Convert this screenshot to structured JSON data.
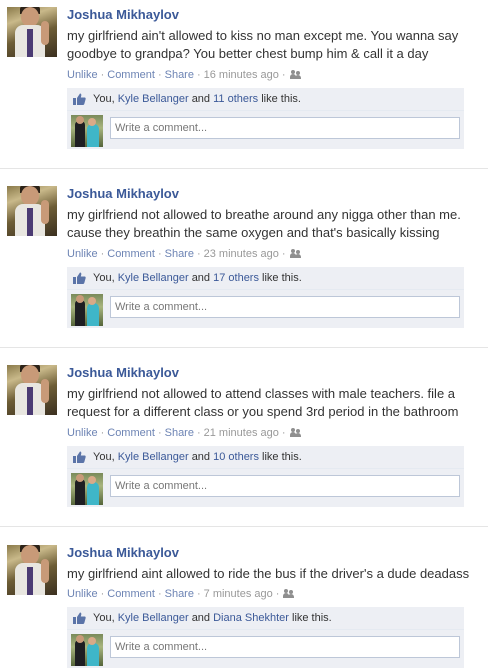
{
  "posts": [
    {
      "author": "Joshua Mikhaylov",
      "message": "my girlfriend ain't allowed to kiss no man except me. You wanna say goodbye to grandpa? You better chest bump him & call it a day",
      "actions": {
        "unlike": "Unlike",
        "comment": "Comment",
        "share": "Share",
        "time": "16 minutes ago"
      },
      "likes": {
        "you": "You,",
        "friend": "Kyle Bellanger",
        "and": "and",
        "others": "11 others",
        "suffix": "like this."
      },
      "comment_placeholder": "Write a comment..."
    },
    {
      "author": "Joshua Mikhaylov",
      "message": "my girlfriend not allowed to breathe around any nigga other than me. cause they breathin the same oxygen and that's basically kissing",
      "actions": {
        "unlike": "Unlike",
        "comment": "Comment",
        "share": "Share",
        "time": "23 minutes ago"
      },
      "likes": {
        "you": "You,",
        "friend": "Kyle Bellanger",
        "and": "and",
        "others": "17 others",
        "suffix": "like this."
      },
      "comment_placeholder": "Write a comment..."
    },
    {
      "author": "Joshua Mikhaylov",
      "message": "my girlfriend not allowed to attend classes with male teachers. file a request for a different class or you spend 3rd period in the bathroom",
      "actions": {
        "unlike": "Unlike",
        "comment": "Comment",
        "share": "Share",
        "time": "21 minutes ago"
      },
      "likes": {
        "you": "You,",
        "friend": "Kyle Bellanger",
        "and": "and",
        "others": "10 others",
        "suffix": "like this."
      },
      "comment_placeholder": "Write a comment..."
    },
    {
      "author": "Joshua Mikhaylov",
      "message": "my girlfriend aint allowed to ride the bus if the driver's a dude deadass",
      "actions": {
        "unlike": "Unlike",
        "comment": "Comment",
        "share": "Share",
        "time": "7 minutes ago"
      },
      "likes": {
        "you": "You,",
        "friend": "Kyle Bellanger",
        "and": "and",
        "others": "Diana Shekhter",
        "suffix": "like this."
      },
      "comment_placeholder": "Write a comment..."
    }
  ],
  "icons": {
    "thumb": "thumbs-up-icon",
    "audience": "friends-audience-icon"
  },
  "colors": {
    "link": "#3b5998",
    "action_link": "#6d84b4",
    "meta": "#999999",
    "ufi_background": "#edeff4"
  }
}
